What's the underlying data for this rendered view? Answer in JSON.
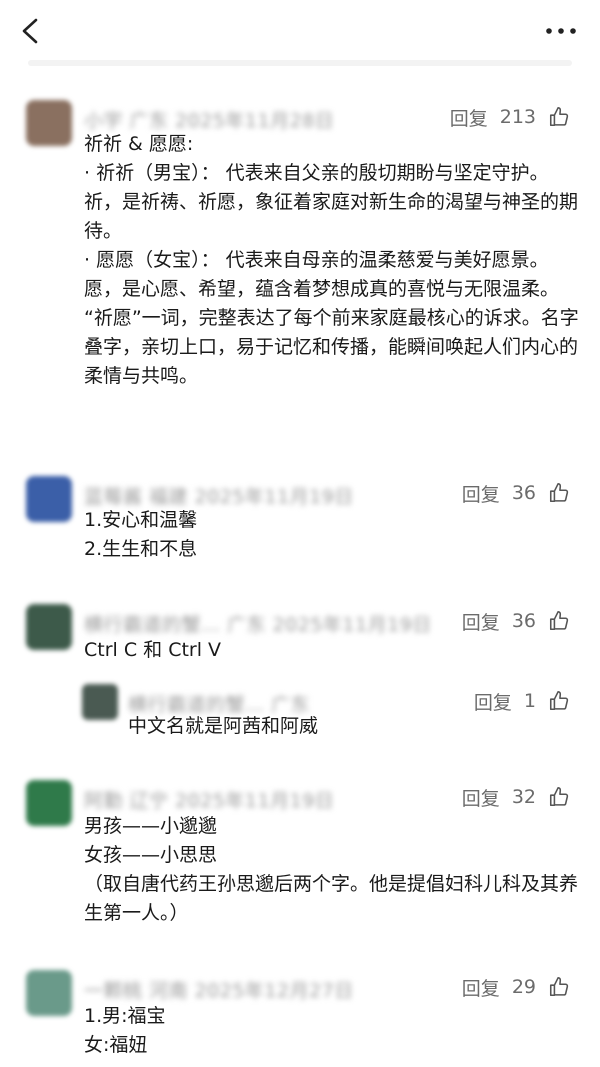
{
  "comments": [
    {
      "meta": "小宇 广东 2025年11月28日",
      "reply": "回复",
      "likes": "213",
      "text": "祈祈 & 愿愿:\n· 祈祈（男宝）： 代表来自父亲的殷切期盼与坚定守护。祈，是祈祷、祈愿，象征着家庭对新生命的渴望与神圣的期待。\n· 愿愿（女宝）： 代表来自母亲的温柔慈爱与美好愿景。愿，是心愿、希望，蕴含着梦想成真的喜悦与无限温柔。\n“祈愿”一词，完整表达了每个前来家庭最核心的诉求。名字叠字，亲切上口，易于记忆和传播，能瞬间唤起人们内心的柔情与共鸣。",
      "avatar_color": "#8a7060"
    },
    {
      "meta": "蓝莓酱 福建 2025年11月19日",
      "reply": "回复",
      "likes": "36",
      "text": "1.安心和温馨\n2.生生和不息",
      "avatar_color": "#3b5fa8"
    },
    {
      "meta": "横行霸道的蟹… 广东 2025年11月19日",
      "reply": "回复",
      "likes": "36",
      "text": "Ctrl C 和 Ctrl V",
      "avatar_color": "#3d5a4a"
    },
    {
      "meta": "横行霸道的蟹… 广东",
      "reply": "回复",
      "likes": "1",
      "text": "中文名就是阿茜和阿威",
      "avatar_color": "#4a5a52"
    },
    {
      "meta": "阿勤 辽宁 2025年11月19日",
      "reply": "回复",
      "likes": "32",
      "text": "男孩——小邈邈\n女孩——小思思\n（取自唐代药王孙思邈后两个字。他是提倡妇科儿科及其养生第一人。）",
      "avatar_color": "#2f7a4a"
    },
    {
      "meta": "一颗桃 河南 2025年12月27日",
      "reply": "回复",
      "likes": "29",
      "text": "1.男:福宝\n女:福妞",
      "avatar_color": "#6a9a8a"
    }
  ]
}
